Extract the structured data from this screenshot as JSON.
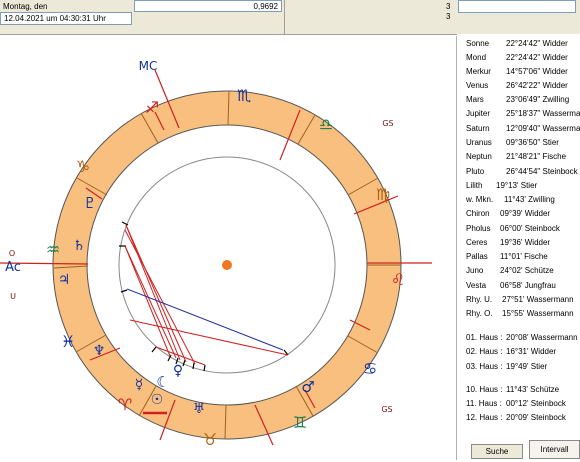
{
  "header": {
    "day_label": "Montag, den",
    "datetime": "12.04.2021  um  04:30:31 Uhr",
    "value": "0,9692",
    "count_1": "3",
    "count_2": "3"
  },
  "chart": {
    "angle_labels": {
      "mc": "MC",
      "ac": "Ac",
      "gs_1": "GS",
      "gs_2": "GS",
      "o": "O",
      "u": "U"
    },
    "zodiac_glyphs": {
      "aries": "♈",
      "taurus": "♉",
      "gemini": "♊",
      "cancer": "♋",
      "leo": "♌",
      "virgo": "♍",
      "libra": "♎",
      "scorpio": "♏",
      "sagittarius": "♐",
      "capricorn": "♑",
      "aquarius": "♒",
      "pisces": "♓"
    },
    "planet_glyphs": {
      "moon": "☾",
      "mercury": "☿",
      "venus": "♀",
      "mars": "♂",
      "jupiter": "♃",
      "saturn": "♄",
      "uranus": "♅",
      "neptune": "♆",
      "pluto": "♇",
      "sun": "☉"
    },
    "colors": {
      "zodiac_band": "#f9bf7f",
      "fire": "#d02020",
      "earth": "#b06010",
      "air": "#208050",
      "water": "#1030a0",
      "center_dot": "#f07820"
    }
  },
  "planets": [
    {
      "name": "Sonne",
      "position": "22°24'42\" Widder"
    },
    {
      "name": "Mond",
      "position": "22°24'42\" Widder"
    },
    {
      "name": "Merkur",
      "position": "14°57'06\" Widder"
    },
    {
      "name": "Venus",
      "position": "26°42'22\" Widder"
    },
    {
      "name": "Mars",
      "position": "23°06'49\" Zwilling"
    },
    {
      "name": "Jupiter",
      "position": "25°18'37\" Wassermann"
    },
    {
      "name": "Saturn",
      "position": "12°09'40\" Wassermann"
    },
    {
      "name": "Uranus",
      "position": "09°36'50\" Stier"
    },
    {
      "name": "Neptun",
      "position": "21°48'21\" Fische"
    },
    {
      "name": "Pluto",
      "position": "26°44'54\" Steinbock"
    }
  ],
  "points": [
    {
      "name": "Lilith",
      "position": "19°13' Stier"
    },
    {
      "name": "w. Mkn.",
      "position": "11°43' Zwilling"
    },
    {
      "name": "Chiron",
      "position": "09°39' Widder"
    },
    {
      "name": "Pholus",
      "position": "06°00' Steinbock"
    },
    {
      "name": "Ceres",
      "position": "19°36' Widder"
    },
    {
      "name": "Pallas",
      "position": "11°01' Fische"
    },
    {
      "name": "Juno",
      "position": "24°02' Schütze"
    },
    {
      "name": "Vesta",
      "position": "06°58' Jungfrau"
    },
    {
      "name": "Rhy. U.",
      "position": "27°51' Wassermann"
    },
    {
      "name": "Rhy. O.",
      "position": "15°55' Wassermann"
    }
  ],
  "houses": [
    {
      "name": "01. Haus :",
      "position": "20°08' Wassermann"
    },
    {
      "name": "02. Haus :",
      "position": "16°31' Widder"
    },
    {
      "name": "03. Haus :",
      "position": "19°49' Stier"
    },
    {
      "name": "10. Haus :",
      "position": "11°43' Schütze"
    },
    {
      "name": "11. Haus :",
      "position": "00°12' Steinbock"
    },
    {
      "name": "12. Haus :",
      "position": "20°09' Steinbock"
    }
  ],
  "buttons": {
    "search": "Suche",
    "interval": "Intervall"
  }
}
